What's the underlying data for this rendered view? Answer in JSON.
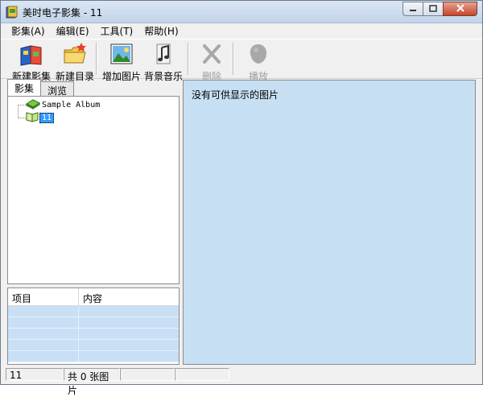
{
  "window": {
    "title": "美时电子影集 - 11",
    "controls": {
      "minimize": "▭",
      "maximize": "□",
      "close": "✕"
    }
  },
  "menu": [
    "影集(A)",
    "编辑(E)",
    "工具(T)",
    "帮助(H)"
  ],
  "toolbar": {
    "new_album": "新建影集",
    "new_folder": "新建目录",
    "add_picture": "增加图片",
    "background_music": "背景音乐",
    "delete": "删除",
    "play": "播放"
  },
  "tabs": [
    "影集",
    "浏览"
  ],
  "tree": {
    "root_label": "Sample Album",
    "child_label": "11"
  },
  "properties": {
    "headers": [
      "项目",
      "内容"
    ]
  },
  "content": {
    "empty_message": "没有可供显示的图片"
  },
  "status": {
    "album": "11",
    "count": "共 0 张图片"
  },
  "colors": {
    "content_bg": "#c7dff2",
    "selection": "#3399ff",
    "grid_row": "#c9dff5"
  }
}
